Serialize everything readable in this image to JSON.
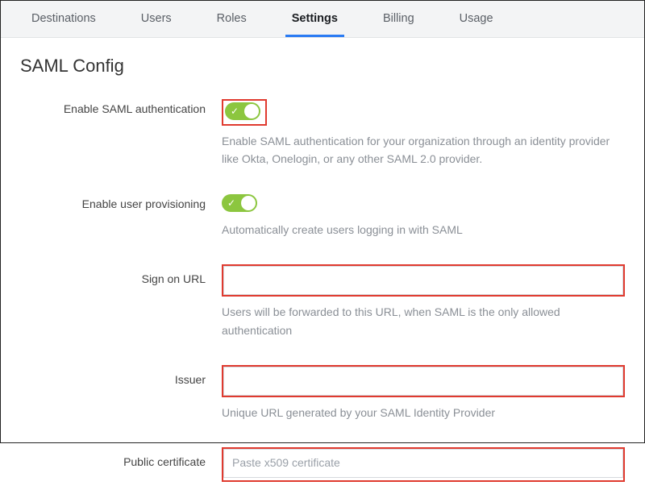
{
  "tabs": {
    "items": [
      {
        "label": "Destinations"
      },
      {
        "label": "Users"
      },
      {
        "label": "Roles"
      },
      {
        "label": "Settings"
      },
      {
        "label": "Billing"
      },
      {
        "label": "Usage"
      }
    ],
    "active_index": 3
  },
  "page": {
    "title": "SAML Config"
  },
  "form": {
    "enable_saml": {
      "label": "Enable SAML authentication",
      "help": "Enable SAML authentication for your organization through an identity provider like Okta, Onelogin, or any other SAML 2.0 provider.",
      "toggle_on": true,
      "highlighted": true
    },
    "enable_provisioning": {
      "label": "Enable user provisioning",
      "help": "Automatically create users logging in with SAML",
      "toggle_on": true,
      "highlighted": false
    },
    "sign_on_url": {
      "label": "Sign on URL",
      "value": "",
      "placeholder": "",
      "help": "Users will be forwarded to this URL, when SAML is the only allowed authentication",
      "highlighted": true
    },
    "issuer": {
      "label": "Issuer",
      "value": "",
      "placeholder": "",
      "help": "Unique URL generated by your SAML Identity Provider",
      "highlighted": true
    },
    "public_certificate": {
      "label": "Public certificate",
      "value": "",
      "placeholder": "Paste x509 certificate",
      "highlighted": true
    }
  }
}
